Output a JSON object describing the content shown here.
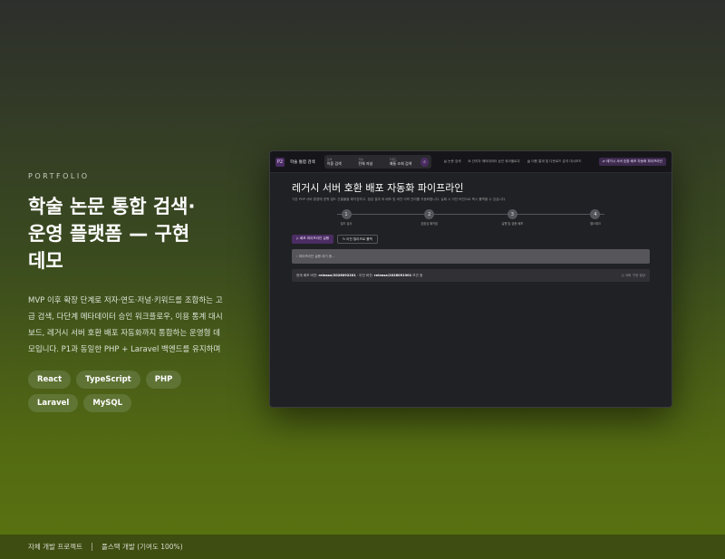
{
  "left": {
    "eyebrow": "PORTFOLIO",
    "title_line1": "학술 논문 통합 검색·",
    "title_line2": "운영 플랫폼 — 구현",
    "title_line3": "데모",
    "description": "MVP 이후 확장 단계로 저자·연도·저널·키워드를 조합하는 고급 검색, 다단계 메타데이터 승인 워크플로우, 이용 통계 대시보드, 레거시 서버 호환 배포 자동화까지 통합하는 운영형 데모입니다. P1과 동일한 PHP + Laravel 백엔드를 유지하며",
    "tags": [
      "React",
      "TypeScript",
      "PHP",
      "Laravel",
      "MySQL"
    ]
  },
  "footer": {
    "item1": "자체 개발 프로젝트",
    "item2": "풀스택 개발 (기여도 100%)"
  },
  "mockup": {
    "logo": "P2",
    "app_name": "학술 통합 검색",
    "search": {
      "f1_label": "검색",
      "f1_value": "이중 검색",
      "f2_label": "저널",
      "f2_value": "전체 저널",
      "f3_label": "키워드",
      "f3_value": "예통 조회 검색",
      "button_icon": "⌕"
    },
    "nav": [
      "▤ 논문 검색",
      "⊞ 관리자 메타데이터 승인 워크플로우",
      "▥ 이용 통계 및 다운로드 분석 대시보드"
    ],
    "nav_cta": "⇄ 레거시 서버 호환 배포 자동화 파이프라인",
    "page_title": "레거시 서버 호환 배포 자동화 파이프라인",
    "page_sub": "기존 PHP 서버 환경에 맞춰 빌드 산출물을 패키징하고, 점검 결과 후 배포 및 버전 이력 관리를 자동화합니다. 실패 시 이전 버전으로 즉시 롤백할 수 있습니다.",
    "steps": [
      {
        "num": "1",
        "label": "빌드 검사"
      },
      {
        "num": "2",
        "label": "호환성 패키징"
      },
      {
        "num": "3",
        "label": "실행 및 검증 배포"
      },
      {
        "num": "4",
        "label": "헬스체크"
      }
    ],
    "run_button": "▷ 배포 파이프라인 실행",
    "rollback_button": "↻ 이전 릴리즈로 롤백",
    "log_placeholder": "› 파이프라인 실행 대기 중...",
    "status_prefix": "현재 배포 버전:",
    "status_current": "release/2026092201",
    "status_mid": "· 이전 버전:",
    "status_prev": "release/2026091901",
    "status_suffix": "보관 중",
    "status_right": "◎ 서버 구성 정상"
  }
}
